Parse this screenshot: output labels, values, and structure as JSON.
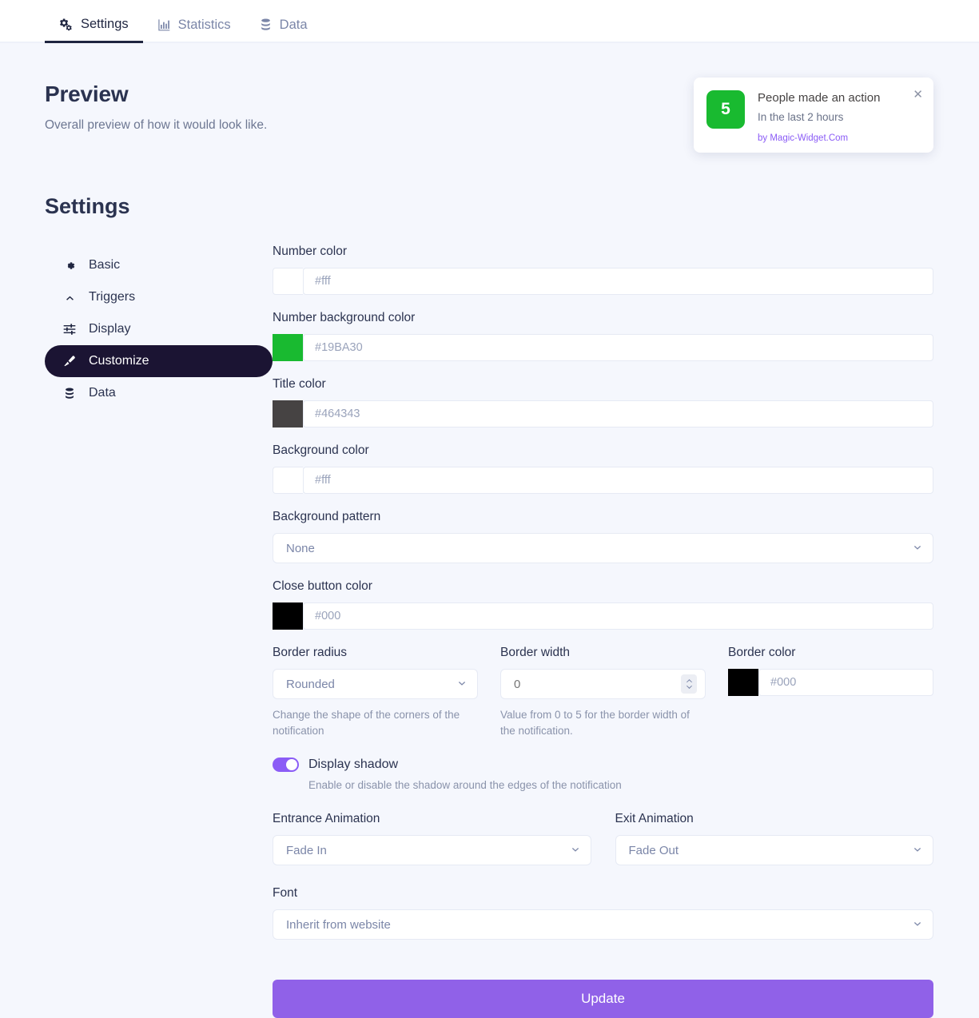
{
  "tabs": [
    {
      "label": "Settings",
      "icon": "cogs-icon",
      "active": true
    },
    {
      "label": "Statistics",
      "icon": "bar-chart-icon",
      "active": false
    },
    {
      "label": "Data",
      "icon": "database-icon",
      "active": false
    }
  ],
  "preview": {
    "title": "Preview",
    "subtitle": "Overall preview of how it would look like."
  },
  "notification": {
    "number": "5",
    "title": "People made an action",
    "subtitle": "In the last 2 hours",
    "credit": "by Magic-Widget.Com",
    "close_icon": "close-icon",
    "number_bg": "#19BA30",
    "title_color": "#464343",
    "credit_color": "#8b5cf6"
  },
  "settings": {
    "heading": "Settings",
    "nav": [
      {
        "label": "Basic",
        "icon": "gear-icon",
        "active": false
      },
      {
        "label": "Triggers",
        "icon": "chevron-up-icon",
        "active": false
      },
      {
        "label": "Display",
        "icon": "sliders-icon",
        "active": false
      },
      {
        "label": "Customize",
        "icon": "brush-icon",
        "active": true
      },
      {
        "label": "Data",
        "icon": "database-icon",
        "active": false
      }
    ]
  },
  "form": {
    "number_color": {
      "label": "Number color",
      "placeholder": "#fff",
      "value": "",
      "swatch": "#ffffff"
    },
    "number_bg_color": {
      "label": "Number background color",
      "placeholder": "#19BA30",
      "value": "",
      "swatch": "#19BA30"
    },
    "title_color": {
      "label": "Title color",
      "placeholder": "#464343",
      "value": "",
      "swatch": "#464343"
    },
    "background_color": {
      "label": "Background color",
      "placeholder": "#fff",
      "value": "",
      "swatch": "#ffffff"
    },
    "background_pattern": {
      "label": "Background pattern",
      "value": "None",
      "options": [
        "None"
      ]
    },
    "close_button_color": {
      "label": "Close button color",
      "placeholder": "#000",
      "value": "",
      "swatch": "#000000"
    },
    "border_radius": {
      "label": "Border radius",
      "value": "Rounded",
      "options": [
        "Rounded"
      ],
      "help": "Change the shape of the corners of the notification"
    },
    "border_width": {
      "label": "Border width",
      "placeholder": "0",
      "value": "",
      "help": "Value from 0 to 5 for the border width of the notification."
    },
    "border_color": {
      "label": "Border color",
      "placeholder": "#000",
      "value": "",
      "swatch": "#000000"
    },
    "display_shadow": {
      "label": "Display shadow",
      "help": "Enable or disable the shadow around the edges of the notification",
      "on": true,
      "accent": "#8b5cf6"
    },
    "entrance_animation": {
      "label": "Entrance Animation",
      "value": "Fade In",
      "options": [
        "Fade In"
      ]
    },
    "exit_animation": {
      "label": "Exit Animation",
      "value": "Fade Out",
      "options": [
        "Fade Out"
      ]
    },
    "font": {
      "label": "Font",
      "value": "Inherit from website",
      "options": [
        "Inherit from website"
      ]
    },
    "update_button": {
      "label": "Update",
      "color": "#9061e8"
    }
  }
}
